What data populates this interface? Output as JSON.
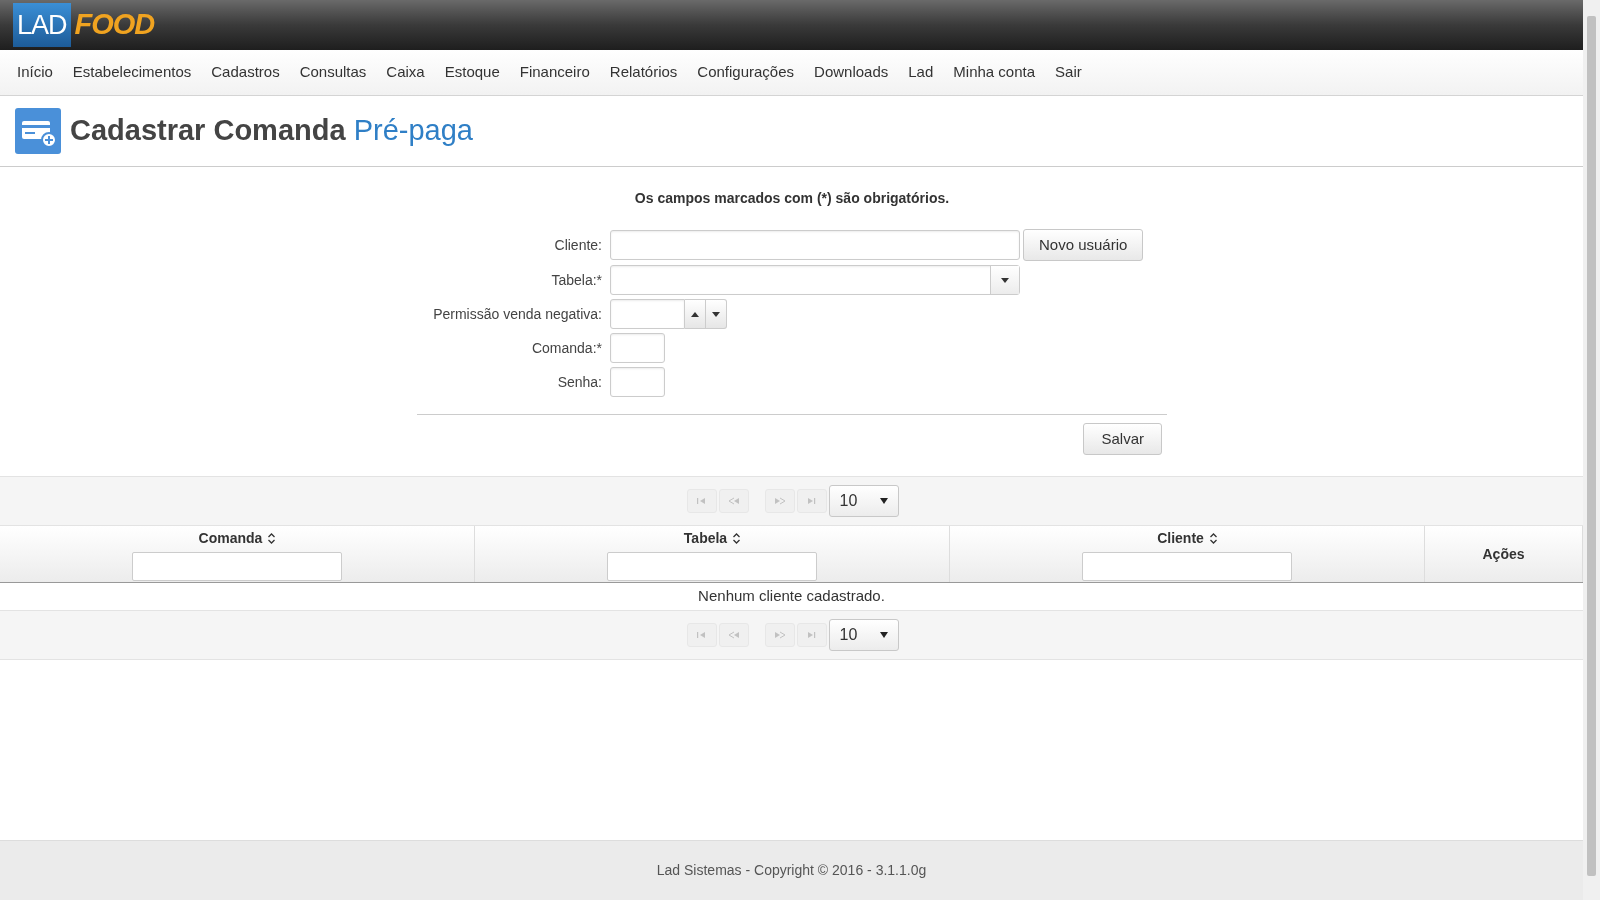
{
  "logo": {
    "part_1": "LAD",
    "part_2": "FOOD"
  },
  "nav": [
    {
      "label": "Início"
    },
    {
      "label": "Estabelecimentos"
    },
    {
      "label": "Cadastros"
    },
    {
      "label": "Consultas"
    },
    {
      "label": "Caixa"
    },
    {
      "label": "Estoque"
    },
    {
      "label": "Financeiro"
    },
    {
      "label": "Relatórios"
    },
    {
      "label": "Configurações"
    },
    {
      "label": "Downloads"
    },
    {
      "label": "Lad"
    },
    {
      "label": "Minha conta"
    },
    {
      "label": "Sair"
    }
  ],
  "page_title": {
    "main": "Cadastrar Comanda",
    "accent": "Pré-paga"
  },
  "form": {
    "note": "Os campos marcados com (*) são obrigatórios.",
    "fields": [
      {
        "label": "Cliente:",
        "kind": "text",
        "button": "Novo usuário"
      },
      {
        "label": "Tabela:*",
        "kind": "select"
      },
      {
        "label": "Permissão venda negativa:",
        "kind": "spinner"
      },
      {
        "label": "Comanda:*",
        "kind": "short"
      },
      {
        "label": "Senha:",
        "kind": "short"
      }
    ],
    "submit": "Salvar"
  },
  "paginator_top": {
    "buttons": [
      {
        "kind": "first",
        "disabled": true
      },
      {
        "kind": "prev",
        "disabled": true
      },
      {
        "kind": "next",
        "disabled": true
      },
      {
        "kind": "last",
        "disabled": true
      }
    ],
    "page_size": "10"
  },
  "table": {
    "columns": [
      {
        "label": "Comanda",
        "sortable": true,
        "filter": true
      },
      {
        "label": "Tabela",
        "sortable": true,
        "filter": true
      },
      {
        "label": "Cliente",
        "sortable": true,
        "filter": true
      },
      {
        "label": "Ações",
        "sortable": false,
        "filter": false
      }
    ],
    "empty_message": "Nenhum cliente cadastrado."
  },
  "paginator_bottom": {
    "buttons": [
      {
        "kind": "first",
        "disabled": true
      },
      {
        "kind": "prev",
        "disabled": true
      },
      {
        "kind": "next",
        "disabled": true
      },
      {
        "kind": "last",
        "disabled": true
      }
    ],
    "page_size": "10"
  },
  "footer": "Lad Sistemas - Copyright © 2016 - 3.1.1.0g"
}
